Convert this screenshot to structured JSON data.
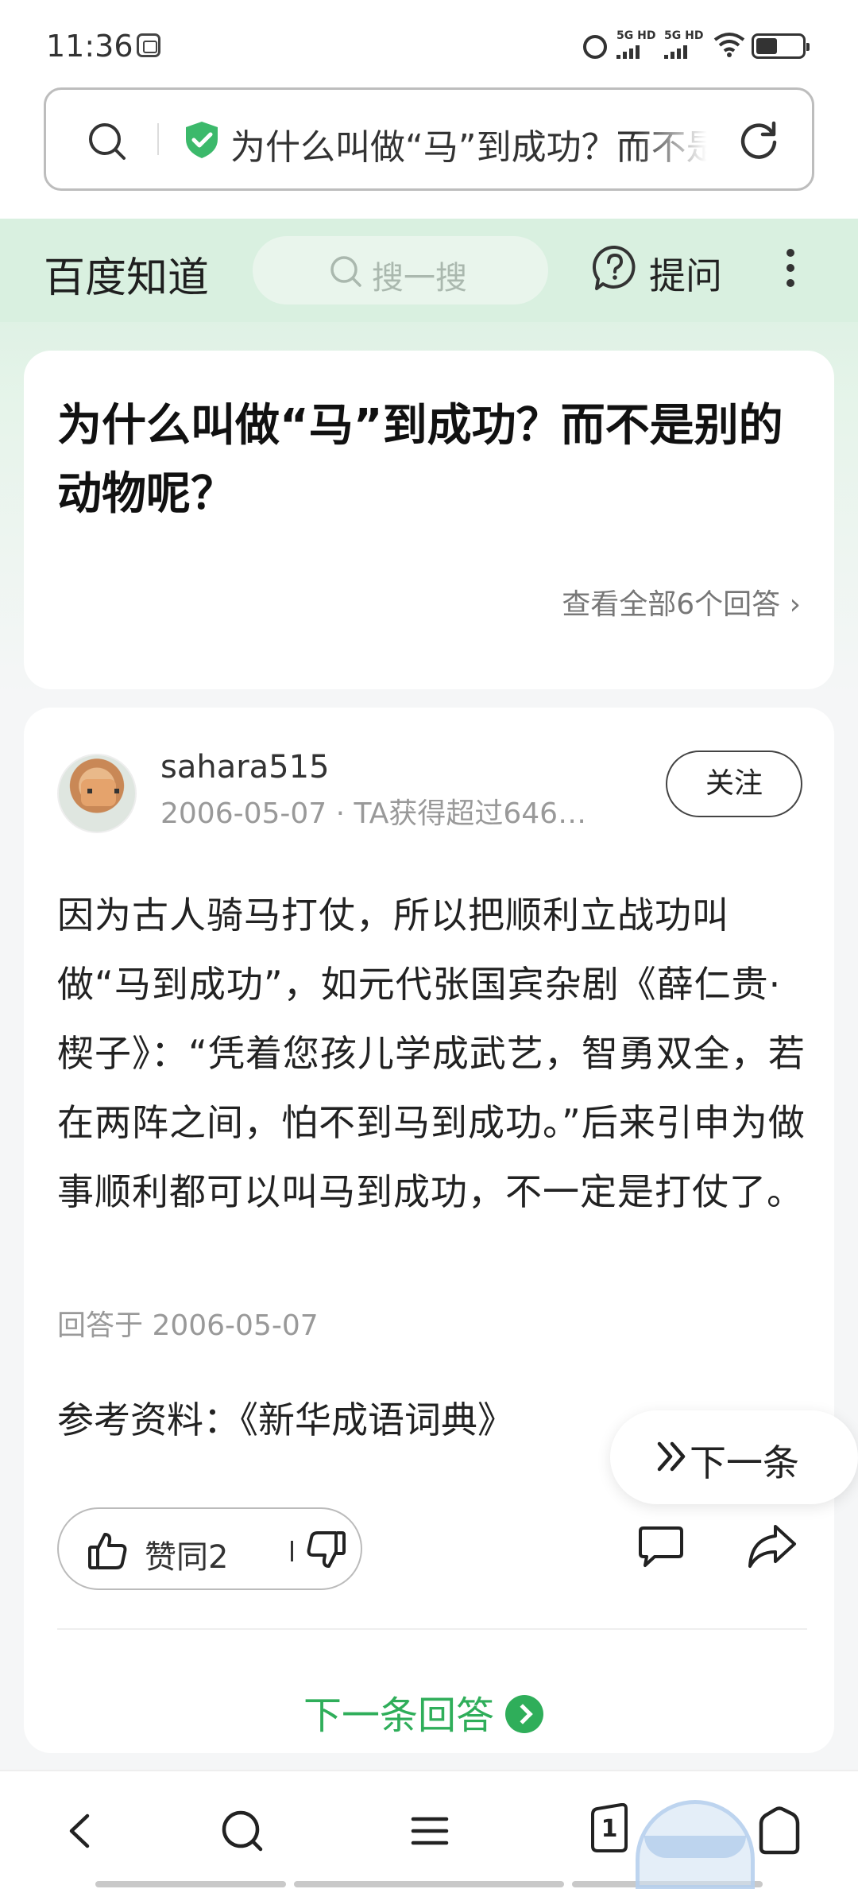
{
  "status_bar": {
    "time": "11:36",
    "network_1": "5G HD",
    "network_2": "5G HD",
    "icons": [
      "app-icon",
      "alarm-icon",
      "signal-icon",
      "wifi-icon",
      "battery-icon"
    ]
  },
  "browser": {
    "url_title": "为什么叫做“马”到成功？而不是别的动物呢？",
    "icons": [
      "search-icon",
      "shield-check-icon",
      "refresh-icon"
    ]
  },
  "site_header": {
    "logo": "百度知道",
    "search_placeholder": "搜一搜",
    "ask_label": "提问"
  },
  "question": {
    "title": "为什么叫做“马”到成功？而不是别的动物呢？",
    "view_all": "查看全部6个回答 ›"
  },
  "answer": {
    "username": "sahara515",
    "meta": "2006-05-07 · TA获得超过646…",
    "follow_label": "关注",
    "body": "因为古人骑马打仗，所以把顺利立战功叫做“马到成功”，如元代张国宾杂剧《薛仁贵·楔子》：“凭着您孩儿学成武艺，智勇双全，若在两阵之间，怕不到马到成功。”后来引申为做事顺利都可以叫马到成功，不一定是打仗了。",
    "answered_at": "回答于 2006-05-07",
    "reference": "参考资料：《新华成语词典》",
    "vote_label": "赞同2",
    "next_answer_label": "下一条回答"
  },
  "floating": {
    "next_label": "下一条"
  },
  "bottom_nav": {
    "tab_count": "1",
    "icons": [
      "back-icon",
      "search-icon",
      "menu-icon",
      "tabs-icon",
      "home-icon"
    ]
  },
  "colors": {
    "accent_green": "#2fae5a",
    "header_green": "#d9f0e0"
  }
}
